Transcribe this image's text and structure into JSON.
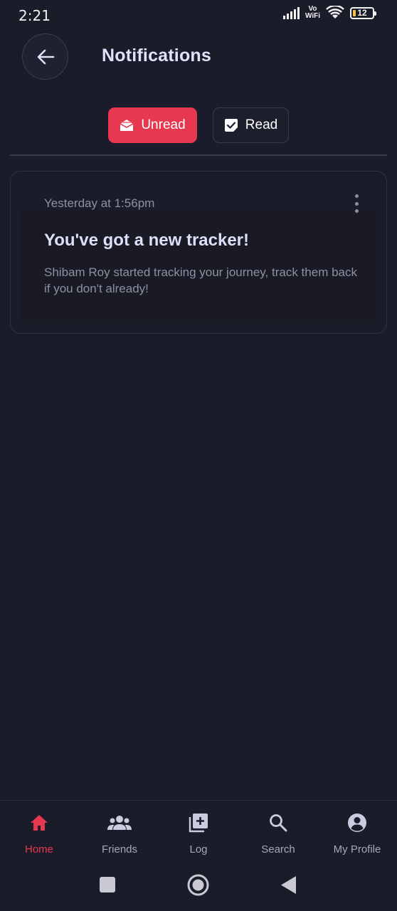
{
  "status_bar": {
    "time": "2:21",
    "network_label_top": "Vo",
    "network_label_bottom": "WiFi",
    "battery": "12"
  },
  "header": {
    "back_icon": "arrow-left-icon",
    "title": "Notifications"
  },
  "tabs": [
    {
      "label": "Unread",
      "icon": "envelope-open-icon",
      "active": true
    },
    {
      "label": "Read",
      "icon": "checked-note-icon",
      "active": false
    }
  ],
  "notifications": [
    {
      "time": "Yesterday at 1:56pm",
      "title": "You've got a new tracker!",
      "body": "Shibam Roy started tracking your journey, track them back if you don't already!"
    }
  ],
  "bottom_nav": [
    {
      "label": "Home",
      "icon": "home-icon",
      "active": true
    },
    {
      "label": "Friends",
      "icon": "group-icon",
      "active": false
    },
    {
      "label": "Log",
      "icon": "add-box-icon",
      "active": false
    },
    {
      "label": "Search",
      "icon": "search-icon",
      "active": false
    },
    {
      "label": "My Profile",
      "icon": "account-circle-icon",
      "active": false
    }
  ],
  "colors": {
    "background": "#1b1c29",
    "accent": "#e63950",
    "title_text": "#dfe2fb",
    "muted_text": "#8d90a4"
  }
}
